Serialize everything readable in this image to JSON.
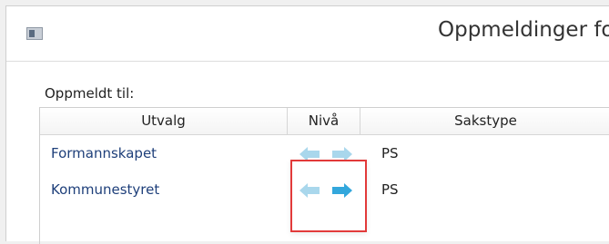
{
  "window": {
    "title": "Oppmeldinger fo"
  },
  "section": {
    "label": "Oppmeldt til:"
  },
  "table": {
    "headers": {
      "utvalg": "Utvalg",
      "niva": "Nivå",
      "sakstype": "Sakstype"
    },
    "rows": [
      {
        "utvalg": "Formannskapet",
        "sakstype": "PS",
        "left_arrow_state": "disabled",
        "right_arrow_state": "disabled"
      },
      {
        "utvalg": "Kommunestyret",
        "sakstype": "PS",
        "left_arrow_state": "disabled",
        "right_arrow_state": "enabled"
      }
    ]
  },
  "icons": {
    "app": "app-window-icon",
    "left": "arrow-left-icon",
    "right": "arrow-right-icon"
  },
  "colors": {
    "highlight": "#e23a3a",
    "arrow_disabled": "#a9d7ec",
    "arrow_enabled": "#33a7dc",
    "link_text": "#1e3f7a"
  }
}
